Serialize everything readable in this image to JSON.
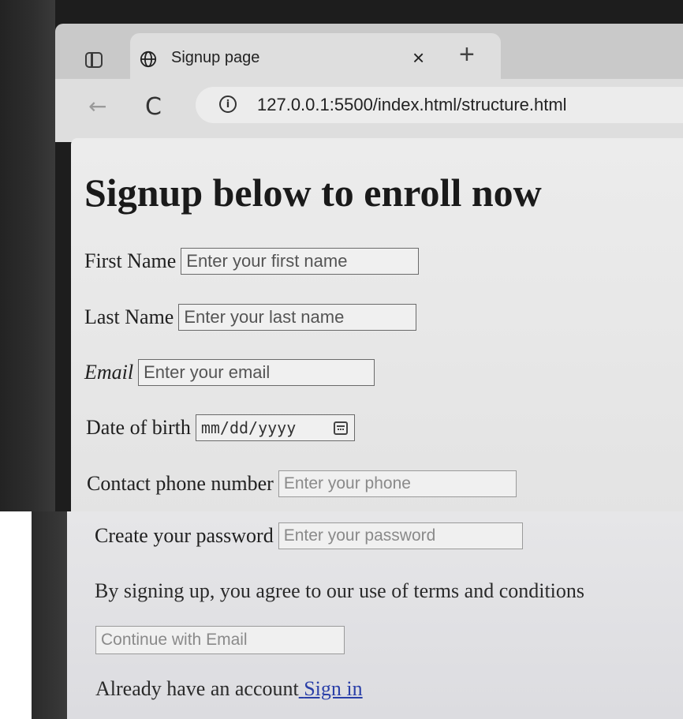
{
  "browser": {
    "tab": {
      "title": "Signup page",
      "close_glyph": "×"
    },
    "new_tab_glyph": "+",
    "back_glyph": "←",
    "reload_glyph": "C",
    "info_glyph": "i",
    "url": "127.0.0.1:5500/index.html/structure.html"
  },
  "form": {
    "heading": "Signup below to enroll now",
    "first_name": {
      "label": "First Name",
      "placeholder": "Enter your first name"
    },
    "last_name": {
      "label": "Last Name",
      "placeholder": "Enter your last name"
    },
    "email": {
      "label": "Email",
      "placeholder": "Enter your email"
    },
    "dob": {
      "label": "Date of birth",
      "placeholder": "mm/dd/yyyy"
    },
    "phone": {
      "label": "Contact phone number",
      "placeholder": "Enter your phone"
    },
    "password": {
      "label": "Create your password",
      "placeholder": "Enter your password"
    },
    "terms_text": "By signing up, you agree to our use of terms and conditions",
    "continue_placeholder": "Continue with Email",
    "account_text": "Already have an account",
    "signin_link": "Sign in"
  },
  "icons": {
    "sidebar": "sidebar-toggle-icon",
    "globe": "globe-icon",
    "info": "info-icon",
    "calendar": "calendar-icon"
  },
  "colors": {
    "link": "#2a3fa8",
    "heading": "#1a1a1a"
  }
}
